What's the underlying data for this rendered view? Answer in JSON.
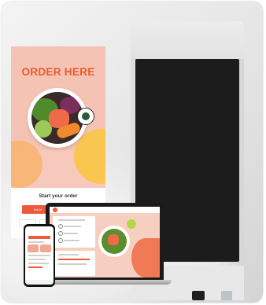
{
  "kiosk": {
    "headline": "ORDER HERE",
    "prompt": "Start your order",
    "buttons": [
      "Eat in",
      "Take out"
    ],
    "chips": [
      "",
      "",
      "",
      ""
    ]
  },
  "colors": {
    "brand_orange": "#ef5a3b",
    "screen_peach": "#f7c9bc",
    "accent_yellow": "#f9c74f"
  },
  "icons": [
    "bowl-image",
    "brand-badge-icon",
    "card-reader-icon",
    "pinpad-icon"
  ]
}
